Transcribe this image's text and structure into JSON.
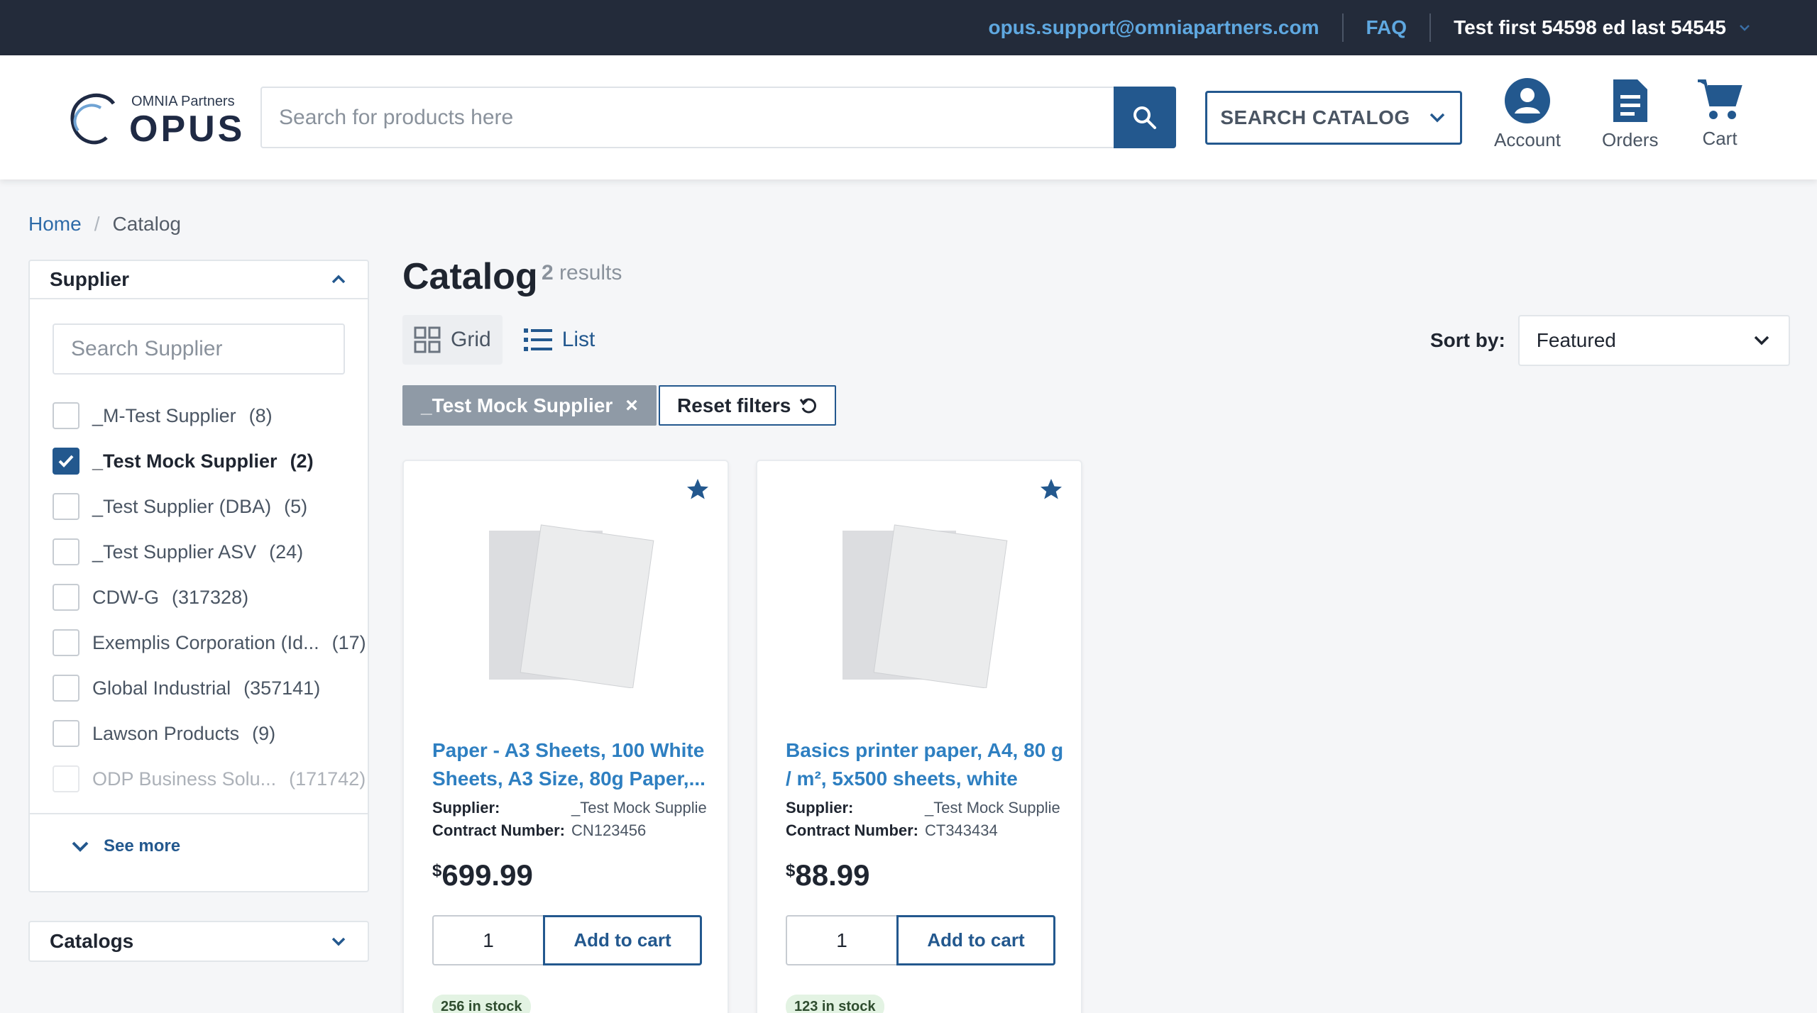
{
  "topbar": {
    "email": "opus.support@omniapartners.com",
    "faq": "FAQ",
    "user": "Test first 54598 ed last 54545"
  },
  "header": {
    "logo_partners": "OMNIA Partners",
    "logo_opus": "OPUS",
    "search_placeholder": "Search for products here",
    "search_catalog": "SEARCH CATALOG",
    "account": "Account",
    "orders": "Orders",
    "cart": "Cart"
  },
  "breadcrumb": {
    "home": "Home",
    "current": "Catalog"
  },
  "sidebar": {
    "supplier_title": "Supplier",
    "supplier_search_placeholder": "Search Supplier",
    "suppliers": [
      {
        "name": "_M-Test Supplier",
        "count": "(8)",
        "checked": false
      },
      {
        "name": "_Test Mock Supplier",
        "count": "(2)",
        "checked": true
      },
      {
        "name": "_Test Supplier (DBA)",
        "count": "(5)",
        "checked": false
      },
      {
        "name": "_Test Supplier ASV",
        "count": "(24)",
        "checked": false
      },
      {
        "name": "CDW-G",
        "count": "(317328)",
        "checked": false
      },
      {
        "name": "Exemplis Corporation (Id...",
        "count": "(17)",
        "checked": false
      },
      {
        "name": "Global Industrial",
        "count": "(357141)",
        "checked": false
      },
      {
        "name": "Lawson Products",
        "count": "(9)",
        "checked": false
      },
      {
        "name": "ODP Business Solu...",
        "count": "(171742)",
        "checked": false
      }
    ],
    "see_more": "See more",
    "catalogs_title": "Catalogs"
  },
  "main": {
    "title": "Catalog",
    "results_count": "2",
    "results_label": "results",
    "view_grid": "Grid",
    "view_list": "List",
    "sort_label": "Sort by:",
    "sort_value": "Featured",
    "active_filter": "_Test Mock Supplier",
    "reset_filters": "Reset filters"
  },
  "products": [
    {
      "name_line1": "Paper - A3 Sheets, 100 White",
      "name_line2": "Sheets, A3 Size, 80g Paper,...",
      "supplier_label": "Supplier:",
      "supplier": "_Test Mock Supplie",
      "contract_label": "Contract Number:",
      "contract": "CN123456",
      "currency": "$",
      "price": "699.99",
      "qty": "1",
      "add_to_cart": "Add to cart",
      "stock": "256 in stock"
    },
    {
      "name_line1": "Basics printer paper, A4, 80 g",
      "name_line2": "/ m², 5x500 sheets, white",
      "supplier_label": "Supplier:",
      "supplier": "_Test Mock Supplie",
      "contract_label": "Contract Number:",
      "contract": "CT343434",
      "currency": "$",
      "price": "88.99",
      "qty": "1",
      "add_to_cart": "Add to cart",
      "stock": "123 in stock"
    }
  ],
  "colors": {
    "topbar_bg": "#232b3a",
    "brand_blue": "#23588e",
    "link_blue": "#2e7fc1",
    "chip_gray": "#8f9aa6"
  }
}
